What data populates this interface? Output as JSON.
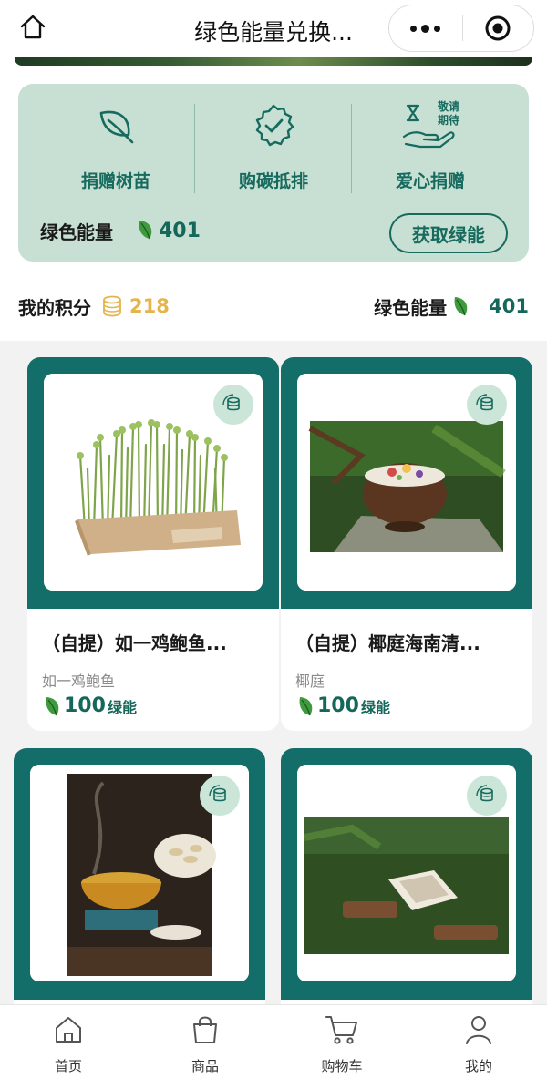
{
  "nav": {
    "title": "绿色能量兑换...",
    "home_icon": "home-icon",
    "more_icon": "more-dots-icon",
    "target_icon": "close-target-icon"
  },
  "panel": {
    "actions": [
      {
        "label": "捐赠树苗",
        "icon": "leaf-icon"
      },
      {
        "label": "购碳抵排",
        "icon": "check-badge-icon"
      },
      {
        "label": "爱心捐赠",
        "icon": "charity-hand-icon",
        "badge_text": "敬请期待"
      }
    ],
    "energy_label": "绿色能量",
    "energy_value": "401",
    "get_button": "获取绿能"
  },
  "points": {
    "my_points_label": "我的积分",
    "my_points_value": "218",
    "green_energy_label": "绿色能量",
    "green_energy_value": "401"
  },
  "products": [
    {
      "name": "（自提）如一鸡鲍鱼...",
      "brand": "如一鸡鲍鱼",
      "price": "100",
      "unit": "绿能",
      "image": "sprouts-in-box"
    },
    {
      "name": "（自提）椰庭海南清...",
      "brand": "椰庭",
      "price": "100",
      "unit": "绿能",
      "image": "coconut-dessert"
    },
    {
      "name": "",
      "brand": "",
      "price": "",
      "unit": "",
      "image": "hot-pot-dumplings"
    },
    {
      "name": "",
      "brand": "",
      "price": "",
      "unit": "",
      "image": "coconut-pudding-on-moss"
    }
  ],
  "tabs": [
    {
      "label": "首页",
      "icon": "home-icon"
    },
    {
      "label": "商品",
      "icon": "shopping-bag-icon"
    },
    {
      "label": "购物车",
      "icon": "cart-icon"
    },
    {
      "label": "我的",
      "icon": "user-icon"
    }
  ],
  "colors": {
    "primary": "#166a5e",
    "panel_bg": "#c7e0d3",
    "card_top": "#136e69",
    "points_gold": "#e3b54c"
  }
}
